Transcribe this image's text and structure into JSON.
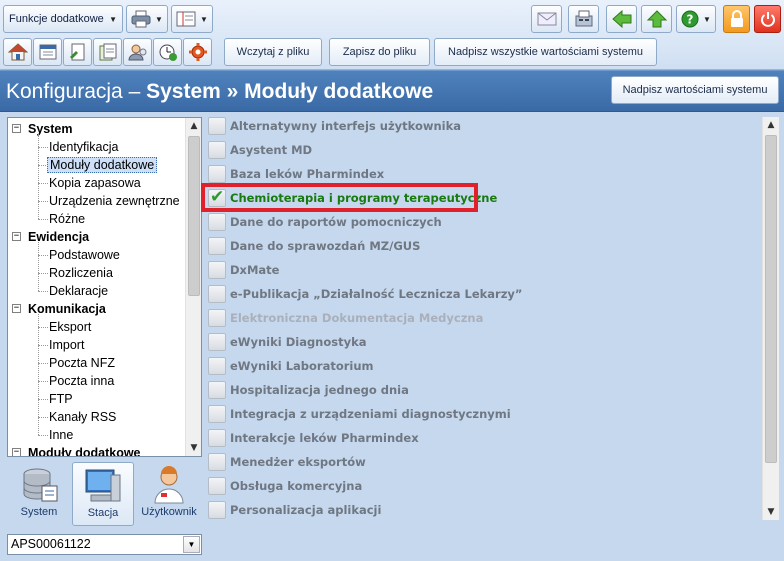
{
  "toolbar": {
    "functions_dropdown": "Funkcje dodatkowe",
    "load_button": "Wczytaj z pliku",
    "save_button": "Zapisz do pliku",
    "overwrite_all_button": "Nadpisz wszystkie wartościami systemu"
  },
  "header": {
    "title_prefix": "Konfiguracja – ",
    "title_main": "System » Moduły dodatkowe",
    "overwrite_button": "Nadpisz wartościami systemu"
  },
  "tree": {
    "groups": [
      {
        "label": "System",
        "items": [
          "Identyfikacja",
          "Moduły dodatkowe",
          "Kopia zapasowa",
          "Urządzenia zewnętrzne",
          "Różne"
        ]
      },
      {
        "label": "Ewidencja",
        "items": [
          "Podstawowe",
          "Rozliczenia",
          "Deklaracje"
        ]
      },
      {
        "label": "Komunikacja",
        "items": [
          "Eksport",
          "Import",
          "Poczta NFZ",
          "Poczta inna",
          "FTP",
          "Kanały RSS",
          "Inne"
        ]
      },
      {
        "label": "Moduły dodatkowe",
        "items": []
      }
    ],
    "selected": "Moduły dodatkowe"
  },
  "modes": [
    {
      "label": "System",
      "active": false
    },
    {
      "label": "Stacja",
      "active": true
    },
    {
      "label": "Użytkownik",
      "active": false
    }
  ],
  "station": "APS00061122",
  "modules": [
    {
      "label": "Alternatywny interfejs użytkownika",
      "checked": false,
      "disabled": false
    },
    {
      "label": "Asystent MD",
      "checked": false,
      "disabled": false
    },
    {
      "label": "Baza leków Pharmindex",
      "checked": false,
      "disabled": false
    },
    {
      "label": "Chemioterapia i programy terapeutyczne",
      "checked": true,
      "disabled": false
    },
    {
      "label": "Dane do raportów pomocniczych",
      "checked": false,
      "disabled": false
    },
    {
      "label": "Dane do sprawozdań MZ/GUS",
      "checked": false,
      "disabled": false
    },
    {
      "label": "DxMate",
      "checked": false,
      "disabled": false
    },
    {
      "label": "e-Publikacja „Działalność Lecznicza Lekarzy”",
      "checked": false,
      "disabled": false
    },
    {
      "label": "Elektroniczna Dokumentacja Medyczna",
      "checked": false,
      "disabled": true
    },
    {
      "label": "eWyniki Diagnostyka",
      "checked": false,
      "disabled": false
    },
    {
      "label": "eWyniki Laboratorium",
      "checked": false,
      "disabled": false
    },
    {
      "label": "Hospitalizacja jednego dnia",
      "checked": false,
      "disabled": false
    },
    {
      "label": "Integracja z urządzeniami diagnostycznymi",
      "checked": false,
      "disabled": false
    },
    {
      "label": "Interakcje leków Pharmindex",
      "checked": false,
      "disabled": false
    },
    {
      "label": "Menedżer eksportów",
      "checked": false,
      "disabled": false
    },
    {
      "label": "Obsługa komercyjna",
      "checked": false,
      "disabled": false
    },
    {
      "label": "Personalizacja aplikacji",
      "checked": false,
      "disabled": false
    }
  ],
  "colors": {
    "header_bg": "#4477b4",
    "checked_text": "#1a7a12",
    "unchecked_text": "#6f7782",
    "highlight": "#e0202a"
  }
}
